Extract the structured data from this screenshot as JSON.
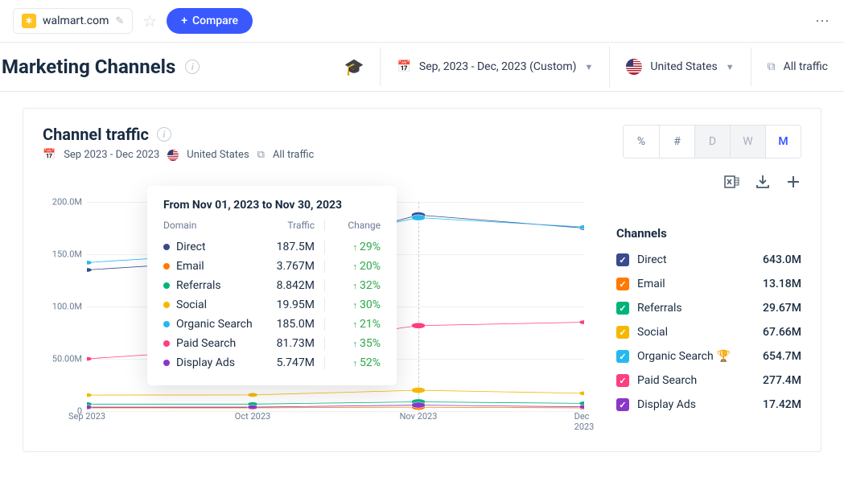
{
  "topbar": {
    "domain": "walmart.com",
    "compare_label": "Compare"
  },
  "header": {
    "title": "Marketing Channels",
    "date_range": "Sep, 2023 - Dec, 2023 (Custom)",
    "country": "United States",
    "traffic_filter": "All traffic"
  },
  "card": {
    "title": "Channel traffic",
    "sub_date": "Sep 2023 - Dec 2023",
    "sub_country": "United States",
    "sub_traffic": "All traffic",
    "toggles": {
      "pct": "%",
      "num": "#",
      "d": "D",
      "w": "W",
      "m": "M"
    }
  },
  "chart_data": {
    "type": "line",
    "categories": [
      "Sep 2023",
      "Oct 2023",
      "Nov 2023",
      "Dec 2023"
    ],
    "ylabel": "",
    "ylim": [
      0,
      200000000
    ],
    "yticks_labels": [
      "0",
      "50.00M",
      "100.0M",
      "150.0M",
      "200.0M"
    ],
    "series": [
      {
        "name": "Direct",
        "color": "#3a4a8c",
        "values": [
          135000000,
          145000000,
          187500000,
          175000000
        ]
      },
      {
        "name": "Email",
        "color": "#ff7a00",
        "values": [
          3139000,
          3139000,
          3767000,
          3100000
        ]
      },
      {
        "name": "Referrals",
        "color": "#00b37a",
        "values": [
          6700000,
          6700000,
          8842000,
          7400000
        ]
      },
      {
        "name": "Social",
        "color": "#f5b800",
        "values": [
          15300000,
          15500000,
          19950000,
          17000000
        ]
      },
      {
        "name": "Organic Search",
        "color": "#27b8f0",
        "values": [
          142000000,
          152000000,
          185000000,
          176000000
        ]
      },
      {
        "name": "Paid Search",
        "color": "#ff3e7f",
        "values": [
          50000000,
          60400000,
          81730000,
          85000000
        ]
      },
      {
        "name": "Display Ads",
        "color": "#8a37c9",
        "values": [
          3800000,
          3800000,
          5747000,
          4100000
        ]
      }
    ]
  },
  "tooltip": {
    "title": "From Nov 01, 2023 to Nov 30, 2023",
    "h_domain": "Domain",
    "h_traffic": "Traffic",
    "h_change": "Change",
    "rows": [
      {
        "name": "Direct",
        "color": "#3a4a8c",
        "traffic": "187.5M",
        "change": "29%"
      },
      {
        "name": "Email",
        "color": "#ff7a00",
        "traffic": "3.767M",
        "change": "20%"
      },
      {
        "name": "Referrals",
        "color": "#00b37a",
        "traffic": "8.842M",
        "change": "32%"
      },
      {
        "name": "Social",
        "color": "#f5b800",
        "traffic": "19.95M",
        "change": "30%"
      },
      {
        "name": "Organic Search",
        "color": "#27b8f0",
        "traffic": "185.0M",
        "change": "21%"
      },
      {
        "name": "Paid Search",
        "color": "#ff3e7f",
        "traffic": "81.73M",
        "change": "35%"
      },
      {
        "name": "Display Ads",
        "color": "#8a37c9",
        "traffic": "5.747M",
        "change": "52%"
      }
    ]
  },
  "legend": {
    "title": "Channels",
    "items": [
      {
        "name": "Direct",
        "color": "#3a4a8c",
        "value": "643.0M",
        "trophy": false
      },
      {
        "name": "Email",
        "color": "#ff7a00",
        "value": "13.18M",
        "trophy": false
      },
      {
        "name": "Referrals",
        "color": "#00b37a",
        "value": "29.67M",
        "trophy": false
      },
      {
        "name": "Social",
        "color": "#f5b800",
        "value": "67.66M",
        "trophy": false
      },
      {
        "name": "Organic Search",
        "color": "#27b8f0",
        "value": "654.7M",
        "trophy": true
      },
      {
        "name": "Paid Search",
        "color": "#ff3e7f",
        "value": "277.4M",
        "trophy": false
      },
      {
        "name": "Display Ads",
        "color": "#8a37c9",
        "value": "17.42M",
        "trophy": false
      }
    ]
  }
}
